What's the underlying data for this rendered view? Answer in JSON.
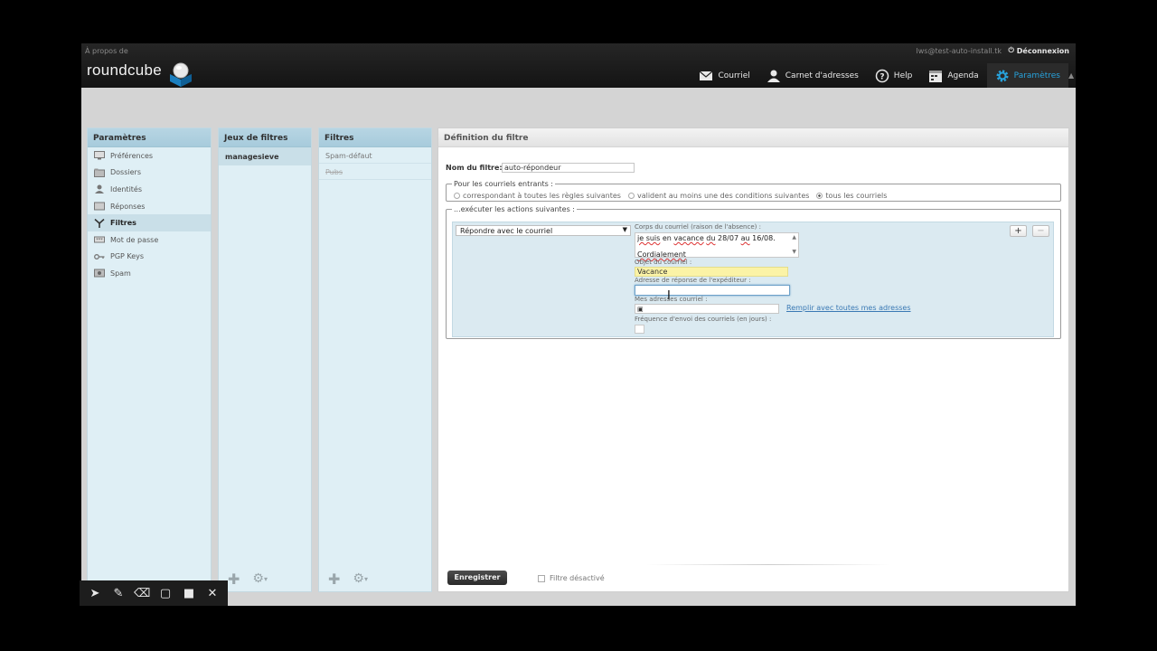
{
  "header": {
    "about": "À propos de",
    "logo": "roundcube",
    "user_email": "lws@test-auto-install.tk",
    "logout": "Déconnexion",
    "nav": [
      {
        "label": "Courriel",
        "icon": "mail-icon"
      },
      {
        "label": "Carnet d'adresses",
        "icon": "contacts-icon"
      },
      {
        "label": "Help",
        "icon": "help-icon"
      },
      {
        "label": "Agenda",
        "icon": "calendar-icon"
      },
      {
        "label": "Paramètres",
        "icon": "gear-icon"
      }
    ]
  },
  "settings": {
    "title": "Paramètres",
    "items": [
      {
        "label": "Préférences",
        "icon": "monitor-icon"
      },
      {
        "label": "Dossiers",
        "icon": "folder-icon"
      },
      {
        "label": "Identités",
        "icon": "person-icon"
      },
      {
        "label": "Réponses",
        "icon": "reply-icon"
      },
      {
        "label": "Filtres",
        "icon": "filter-icon"
      },
      {
        "label": "Mot de passe",
        "icon": "password-icon"
      },
      {
        "label": "PGP Keys",
        "icon": "key-icon"
      },
      {
        "label": "Spam",
        "icon": "spam-icon"
      }
    ]
  },
  "filter_sets": {
    "title": "Jeux de filtres",
    "items": [
      "managesieve"
    ]
  },
  "filters": {
    "title": "Filtres",
    "items": [
      "Spam-défaut",
      "Pubs"
    ]
  },
  "definition": {
    "title": "Définition du filtre",
    "name_label": "Nom du filtre:",
    "name_value": "auto-répondeur",
    "incoming_legend": "Pour les courriels entrants :",
    "radio_all_rules": "correspondant à toutes les règles suivantes",
    "radio_any_rule": "valident au moins une des conditions suivantes",
    "radio_all_mail": "tous les courriels",
    "actions_legend": "...exécuter les actions suivantes :",
    "action_value": "Répondre avec le courriel",
    "body_label": "Corps du courriel (raison de l'absence) :",
    "body_line1_a": "je suis",
    "body_line1_b": "en",
    "body_line1_c": "vacance",
    "body_line1_d": "du",
    "body_line1_e": "28/07",
    "body_line1_f": "au",
    "body_line1_g": "16/08.",
    "body_line2": "Cordialement",
    "subject_label": "Objet du courriel :",
    "subject_value": "Vacance",
    "reply_label": "Adresse de réponse de l'expéditeur :",
    "reply_value": "",
    "my_addr_label": "Mes adresses courriel :",
    "fill_link": "Remplir avec toutes mes adresses",
    "freq_label": "Fréquence d'envoi des courriels (en jours) :",
    "add_btn": "+",
    "remove_btn": "−",
    "save": "Enregistrer",
    "disabled_label": "Filtre désactivé"
  }
}
